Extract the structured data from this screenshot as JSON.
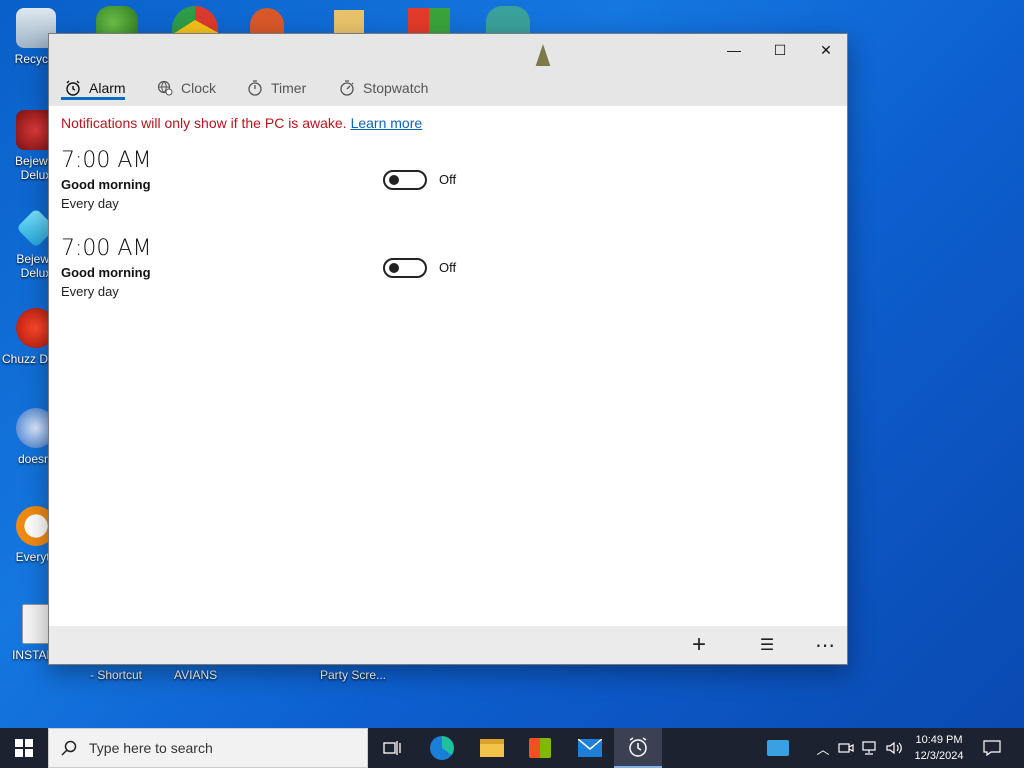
{
  "desktop": {
    "icons": [
      {
        "label": "Recycle"
      },
      {
        "label": "Bejewel Delux"
      },
      {
        "label": "Bejewe Delux"
      },
      {
        "label": "Chuzz Delux"
      },
      {
        "label": "doesnt"
      },
      {
        "label": "Everyth"
      },
      {
        "label": "INSTALL"
      }
    ],
    "bottom_labels": [
      "- Shortcut",
      "AVIANS",
      "Party Scre..."
    ]
  },
  "window": {
    "controls": {
      "minimize": "—",
      "maximize": "☐",
      "close": "✕"
    },
    "tabs": [
      {
        "label": "Alarm",
        "icon": "alarm-icon",
        "active": true
      },
      {
        "label": "Clock",
        "icon": "world-clock-icon",
        "active": false
      },
      {
        "label": "Timer",
        "icon": "timer-icon",
        "active": false
      },
      {
        "label": "Stopwatch",
        "icon": "stopwatch-icon",
        "active": false
      }
    ],
    "notice": {
      "text": "Notifications will only show if the PC is awake.",
      "link": "Learn more"
    },
    "alarms": [
      {
        "time": "7:00 AM",
        "name": "Good morning",
        "repeat": "Every day",
        "state": "Off"
      },
      {
        "time": "7:00 AM",
        "name": "Good morning",
        "repeat": "Every day",
        "state": "Off"
      }
    ],
    "bottom_actions": [
      {
        "icon": "add-icon",
        "glyph": "+"
      },
      {
        "icon": "select-list-icon",
        "glyph": "☰"
      },
      {
        "icon": "more-icon",
        "glyph": "⋯"
      }
    ]
  },
  "taskbar": {
    "search_placeholder": "Type here to search",
    "clock_time": "10:49 PM",
    "clock_date": "12/3/2024",
    "colors": {
      "background": "#1d2230",
      "accent": "#0a6bc4"
    }
  }
}
